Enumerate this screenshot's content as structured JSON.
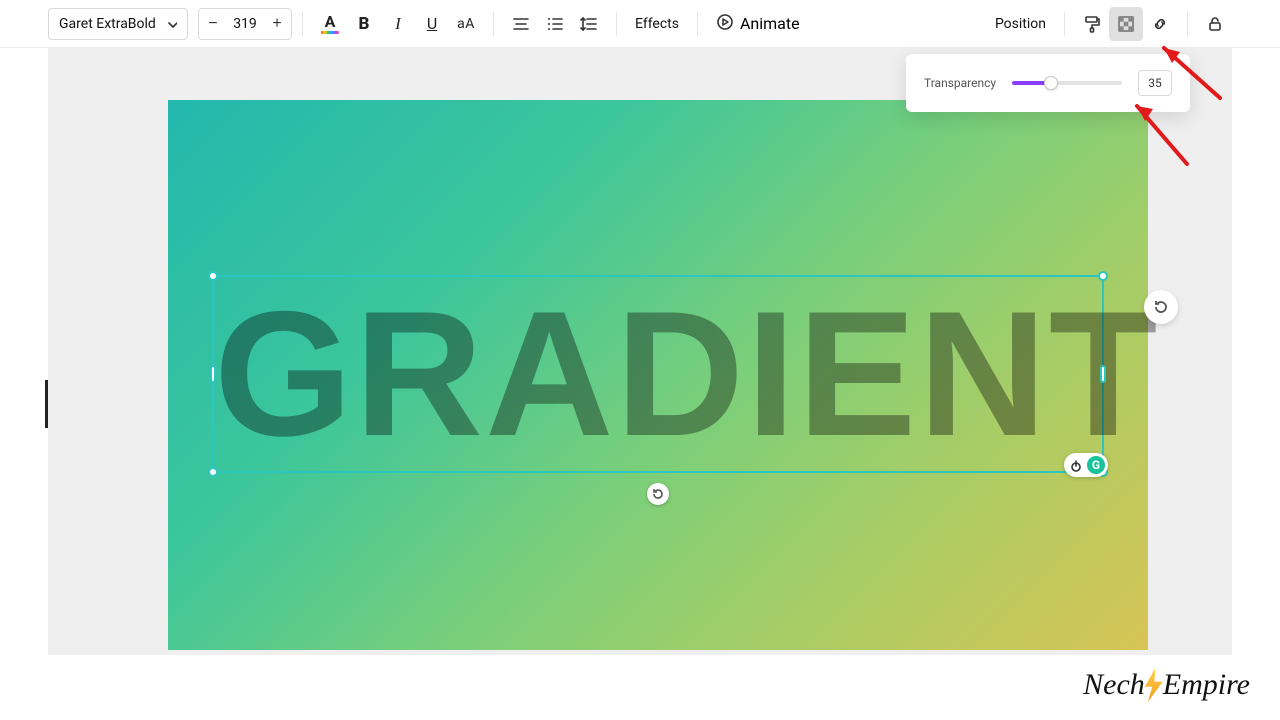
{
  "toolbar": {
    "font_name": "Garet ExtraBold",
    "minus": "−",
    "plus": "+",
    "font_size": "319",
    "bold": "B",
    "italic": "I",
    "underline": "U",
    "case": "aA",
    "color_letter": "A",
    "effects": "Effects",
    "animate": "Animate",
    "position": "Position"
  },
  "popover": {
    "label": "Transparency",
    "value": "35",
    "percent": 35
  },
  "canvas": {
    "text": "GRADIENT"
  },
  "grammarly": {
    "g": "G"
  },
  "watermark": {
    "left": "Nech",
    "right": "Empire"
  }
}
